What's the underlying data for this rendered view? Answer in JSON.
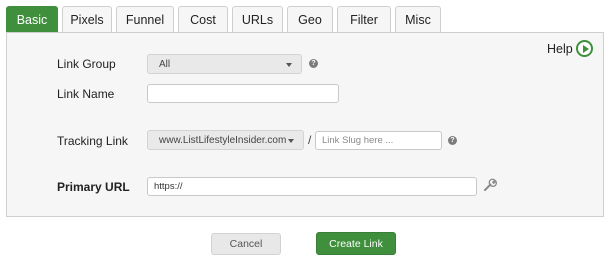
{
  "tabs": [
    {
      "label": "Basic",
      "active": true
    },
    {
      "label": "Pixels",
      "active": false
    },
    {
      "label": "Funnel",
      "active": false
    },
    {
      "label": "Cost",
      "active": false
    },
    {
      "label": "URLs",
      "active": false
    },
    {
      "label": "Geo",
      "active": false
    },
    {
      "label": "Filter",
      "active": false
    },
    {
      "label": "Misc",
      "active": false
    }
  ],
  "help": {
    "label": "Help",
    "icon": "play-circle-icon"
  },
  "form": {
    "link_group": {
      "label": "Link Group",
      "value": "All",
      "help_icon": "question-circle-icon"
    },
    "link_name": {
      "label": "Link Name",
      "value": ""
    },
    "tracking_link": {
      "label": "Tracking Link",
      "domain": "www.ListLifestyleInsider.com",
      "separator": "/",
      "slug_placeholder": "Link Slug here ...",
      "help_icon": "question-circle-icon"
    },
    "primary_url": {
      "label": "Primary URL",
      "value": "https://",
      "tool_icon": "wrench-icon"
    }
  },
  "buttons": {
    "cancel": "Cancel",
    "create": "Create Link"
  },
  "colors": {
    "accent": "#3f8f3d",
    "panel_bg": "#f6f6f6",
    "border": "#cfcfcf"
  }
}
